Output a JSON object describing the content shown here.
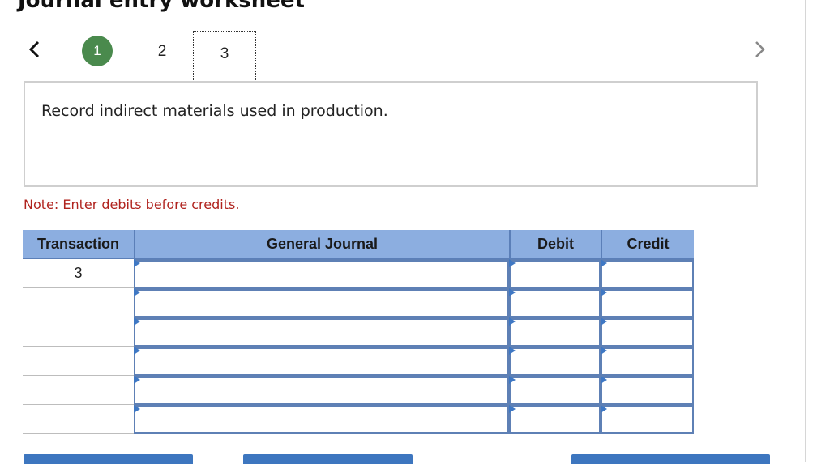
{
  "title": "Journal entry worksheet",
  "nav": {
    "prev_icon": "chevron-left-icon",
    "next_icon": "chevron-right-icon",
    "steps": [
      "1",
      "2",
      "3"
    ],
    "current_step": "3",
    "completed_step_color": "#4a8a4d"
  },
  "instruction": "Record indirect materials used in production.",
  "note": "Note: Enter debits before credits.",
  "journal": {
    "headers": [
      "Transaction",
      "General Journal",
      "Debit",
      "Credit"
    ],
    "header_color": "#8caee0",
    "rows": [
      {
        "transaction": "3",
        "account": "",
        "debit": "",
        "credit": ""
      },
      {
        "transaction": "",
        "account": "",
        "debit": "",
        "credit": ""
      },
      {
        "transaction": "",
        "account": "",
        "debit": "",
        "credit": ""
      },
      {
        "transaction": "",
        "account": "",
        "debit": "",
        "credit": ""
      },
      {
        "transaction": "",
        "account": "",
        "debit": "",
        "credit": ""
      },
      {
        "transaction": "",
        "account": "",
        "debit": "",
        "credit": ""
      }
    ]
  },
  "buttons": {
    "color": "#3d76bf"
  }
}
